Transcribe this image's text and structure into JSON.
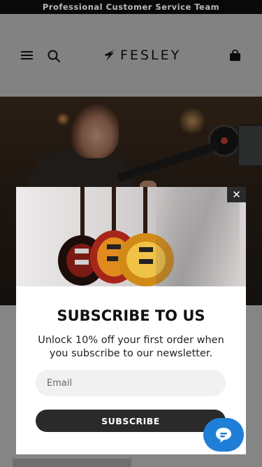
{
  "announcement": {
    "text": "Professional Customer Service Team"
  },
  "header": {
    "menu_icon": "hamburger-menu-icon",
    "search_icon": "search-icon",
    "logo_text": "FESLEY",
    "cart_icon": "shopping-bag-icon"
  },
  "popup": {
    "close_label": "✕",
    "title": "SUBSCRIBE TO US",
    "description": "Unlock 10% off your first order when you subscribe to our newsletter.",
    "email_placeholder": "Email",
    "email_value": "",
    "subscribe_label": "SUBSCRIBE"
  },
  "chat": {
    "icon": "chat-bubble-icon"
  },
  "colors": {
    "announcement_bg": "#0d0d0d",
    "chat_bg": "#1f7fd6",
    "button_bg": "#2a2a2a"
  }
}
